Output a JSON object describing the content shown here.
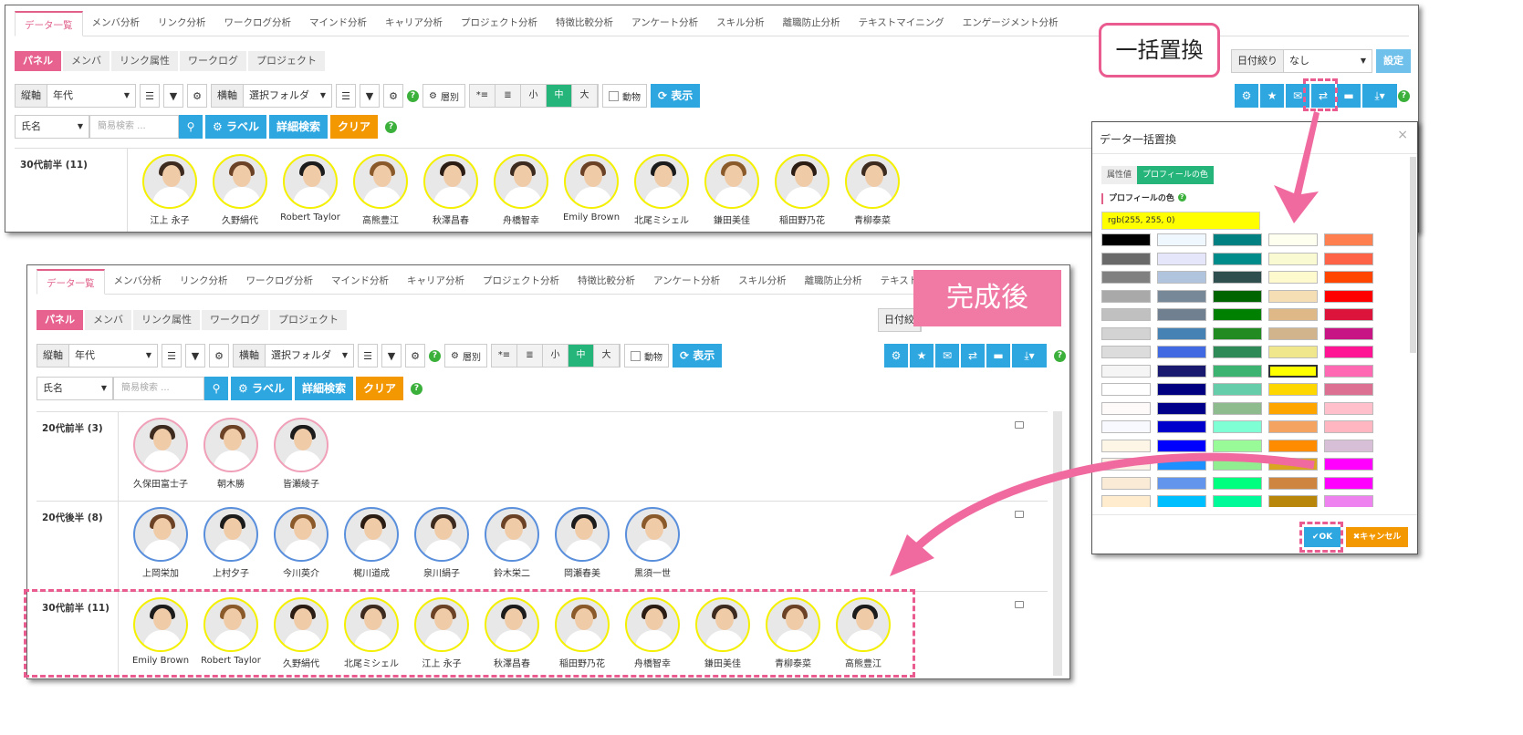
{
  "tabs": [
    "データ一覧",
    "メンバ分析",
    "リンク分析",
    "ワークログ分析",
    "マインド分析",
    "キャリア分析",
    "プロジェクト分析",
    "特徴比較分析",
    "アンケート分析",
    "スキル分析",
    "離職防止分析",
    "テキストマイニング",
    "エンゲージメント分析"
  ],
  "tabs_bottom": [
    "データ一覧",
    "メンバ分析",
    "リンク分析",
    "ワークログ分析",
    "マインド分析",
    "キャリア分析",
    "プロジェクト分析",
    "特徴比較分析",
    "アンケート分析",
    "スキル分析",
    "離職防止分析",
    "テキストマイニ"
  ],
  "pills": [
    "パネル",
    "メンバ",
    "リンク属性",
    "ワークログ",
    "プロジェクト"
  ],
  "controls": {
    "vertical_label": "縦軸",
    "vertical_value": "年代",
    "horizontal_label": "横軸",
    "horizontal_value": "選択フォルダ",
    "layer": "層別",
    "small": "小",
    "medium": "中",
    "large": "大",
    "animal": "動物",
    "show": "表示",
    "name_field": "氏名",
    "search_placeholder": "簡易検索 ...",
    "label_btn": "ラベル",
    "adv_search": "詳細検索",
    "clear": "クリア",
    "date_filter": "日付絞り",
    "date_value": "なし",
    "set": "設定",
    "date_filter_bottom": "日付絞"
  },
  "callouts": {
    "bulk_replace": "一括置換",
    "after": "完成後"
  },
  "top_section": {
    "label": "30代前半 (11)",
    "people": [
      "江上 永子",
      "久野絹代",
      "Robert Taylor",
      "高熊豊江",
      "秋澤昌春",
      "舟橋智幸",
      "Emily Brown",
      "北尾ミシェル",
      "鎌田美佳",
      "稲田野乃花",
      "青柳泰菜"
    ]
  },
  "bottom_sections": [
    {
      "label": "20代前半 (3)",
      "border": "pink",
      "people": [
        "久保田富士子",
        "朝木勝",
        "皆瀬綾子"
      ]
    },
    {
      "label": "20代後半 (8)",
      "border": "blue",
      "people": [
        "上岡栄加",
        "上村夕子",
        "今川英介",
        "梶川道成",
        "泉川絹子",
        "鈴木栄二",
        "岡瀬春美",
        "黒須一世"
      ]
    },
    {
      "label": "30代前半 (11)",
      "border": "yellow",
      "people": [
        "Emily Brown",
        "Robert Taylor",
        "久野絹代",
        "北尾ミシェル",
        "江上 永子",
        "秋澤昌春",
        "稲田野乃花",
        "舟橋智幸",
        "鎌田美佳",
        "青柳泰菜",
        "高熊豊江"
      ]
    }
  ],
  "dialog": {
    "title": "データ一括置換",
    "tab_attr": "属性値",
    "tab_color": "プロフィールの色",
    "section": "プロフィールの色",
    "value": "rgb(255, 255, 0)",
    "ok": "OK",
    "cancel": "キャンセル"
  },
  "palette": [
    [
      "#000000",
      "#f0f8ff",
      "#008080",
      "#fffff0",
      "#ff7f50"
    ],
    [
      "#696969",
      "#e6e6fa",
      "#008b8b",
      "#fafad2",
      "#ff6347"
    ],
    [
      "#808080",
      "#b0c4de",
      "#2f4f4f",
      "#fffacd",
      "#ff4500"
    ],
    [
      "#a9a9a9",
      "#778899",
      "#006400",
      "#f5deb3",
      "#ff0000"
    ],
    [
      "#c0c0c0",
      "#708090",
      "#008000",
      "#deb887",
      "#dc143c"
    ],
    [
      "#d3d3d3",
      "#4682b4",
      "#228b22",
      "#d2b48c",
      "#c71585"
    ],
    [
      "#dcdcdc",
      "#4169e1",
      "#2e8b57",
      "#f0e68c",
      "#ff1493"
    ],
    [
      "#f5f5f5",
      "#191970",
      "#3cb371",
      "#ffff00",
      "#ff69b4"
    ],
    [
      "#ffffff",
      "#000080",
      "#66cdaa",
      "#ffd700",
      "#db7093"
    ],
    [
      "#fffafa",
      "#00008b",
      "#8fbc8f",
      "#ffa500",
      "#ffc0cb"
    ],
    [
      "#f8f8ff",
      "#0000cd",
      "#7fffd4",
      "#f4a460",
      "#ffb6c1"
    ],
    [
      "#fdf5e6",
      "#0000ff",
      "#98fb98",
      "#ff8c00",
      "#d8bfd8"
    ],
    [
      "#faf0e6",
      "#1e90ff",
      "#90ee90",
      "#daa520",
      "#ff00ff"
    ],
    [
      "#faebd7",
      "#6495ed",
      "#00ff7f",
      "#cd853f",
      "#ff00ff"
    ],
    [
      "#ffebcd",
      "#00bfff",
      "#00fa9a",
      "#b8860b",
      "#ee82ee"
    ]
  ]
}
